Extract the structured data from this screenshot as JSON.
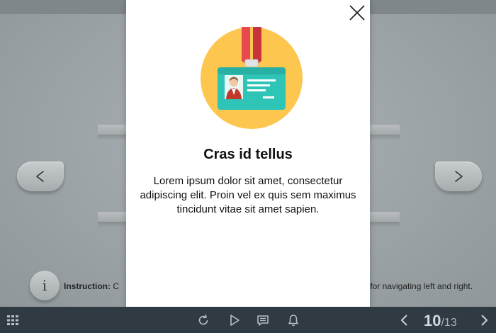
{
  "modal": {
    "title": "Cras id tellus",
    "body": "Lorem ipsum dolor sit amet, consectetur adipiscing elit. Proin vel ex quis sem maximus tincidunt vitae sit amet sapien."
  },
  "instruction": {
    "label": "Instruction:",
    "text_start": "C",
    "text_end": "s for navigating left and right."
  },
  "info_button": {
    "glyph": "i"
  },
  "pagination": {
    "current": "10",
    "total": "/13"
  },
  "colors": {
    "bottombar": "#2f3a42",
    "badge_circle": "#fcc64f",
    "card": "#2ec4b6",
    "lanyard": "#e8494f"
  },
  "icons": [
    "close-icon",
    "badge-icon",
    "chevron-left-icon",
    "chevron-right-icon",
    "info-icon",
    "menu-grid-icon",
    "replay-icon",
    "play-icon",
    "notes-icon",
    "bell-icon"
  ]
}
